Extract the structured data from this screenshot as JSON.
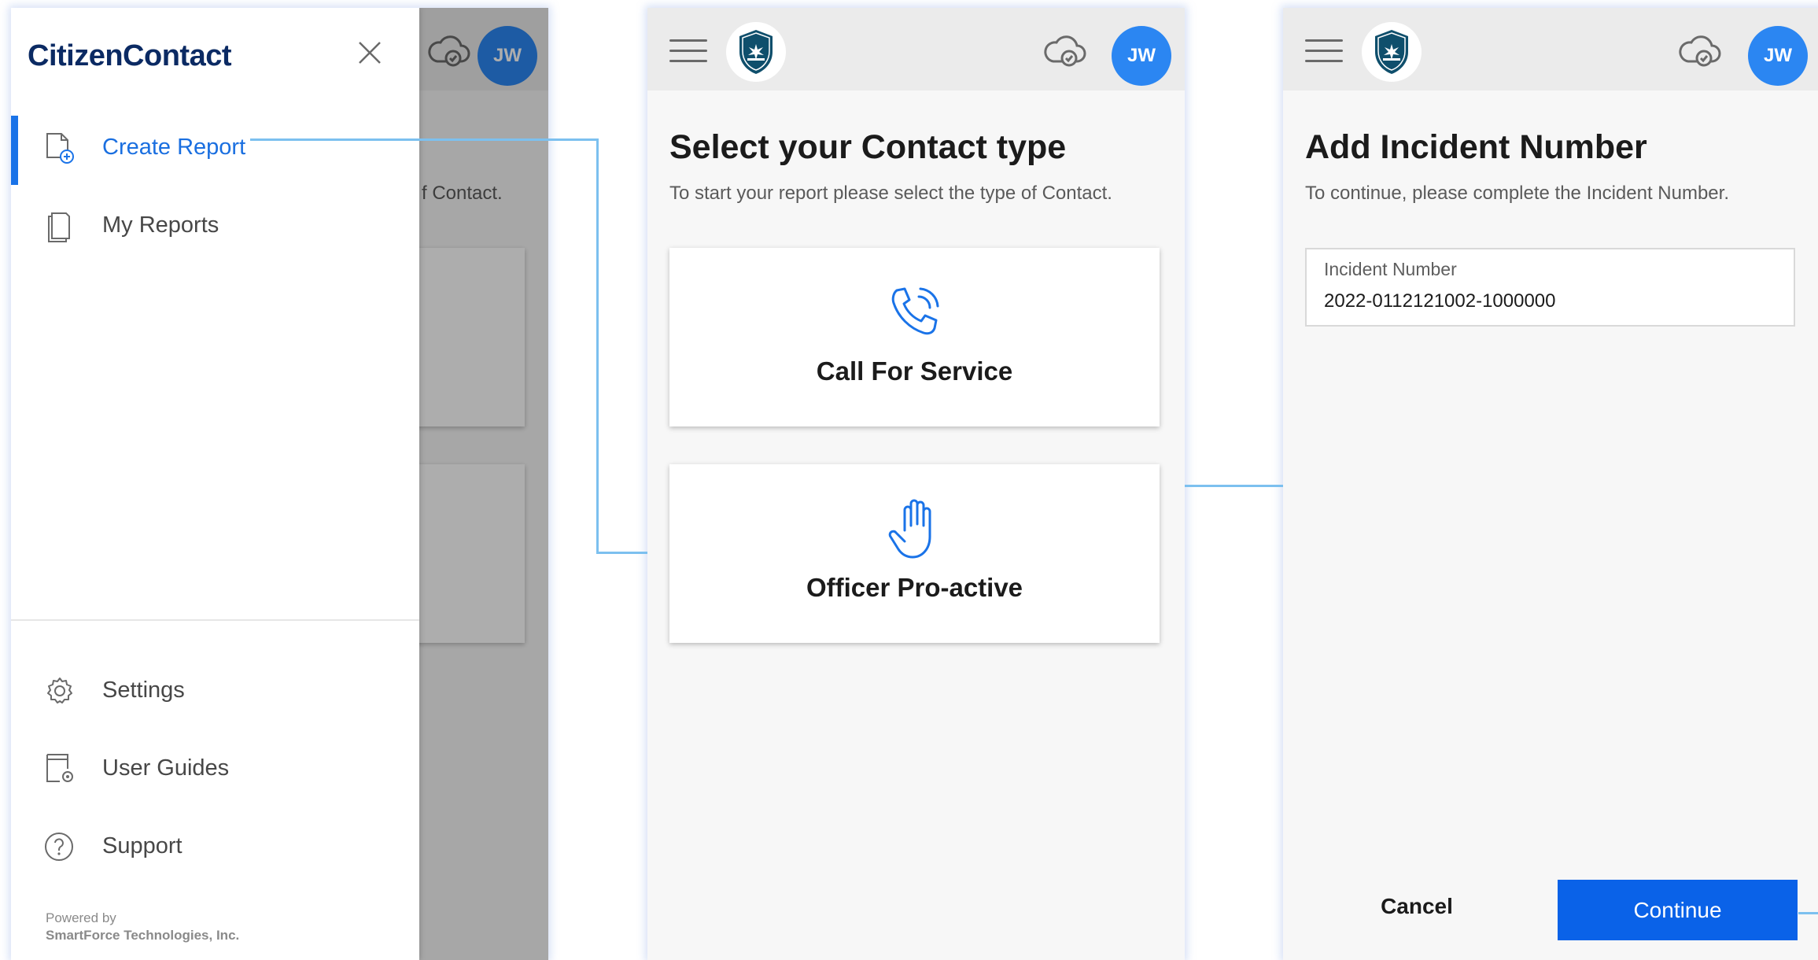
{
  "colors": {
    "accent": "#1a73e8",
    "primary_button": "#0a62e8",
    "avatar": "#2b86f2",
    "brand_navy": "#0b2a63",
    "connector": "#7cc0ef"
  },
  "header": {
    "avatar_initials": "JW",
    "menu_icon": "hamburger-icon",
    "badge_icon": "police-badge-icon",
    "sync_icon": "cloud-check-icon"
  },
  "drawer": {
    "brand": "CitizenContact",
    "close_icon": "close-icon",
    "items": [
      {
        "label": "Create Report",
        "icon": "create-report-icon",
        "active": true
      },
      {
        "label": "My Reports",
        "icon": "reports-icon",
        "active": false
      }
    ],
    "footer_items": [
      {
        "label": "Settings",
        "icon": "gear-icon"
      },
      {
        "label": "User Guides",
        "icon": "user-guides-icon"
      },
      {
        "label": "Support",
        "icon": "help-icon"
      }
    ],
    "powered_by": "Powered by",
    "company": "SmartForce Technologies, Inc."
  },
  "background_page": {
    "subtitle_fragment": "f Contact."
  },
  "contact_type": {
    "title": "Select your Contact type",
    "subtitle": "To start your report please select the type of Contact.",
    "options": [
      {
        "label": "Call For Service",
        "icon": "phone-call-icon"
      },
      {
        "label": "Officer Pro-active",
        "icon": "raised-hand-icon"
      }
    ]
  },
  "incident": {
    "title": "Add Incident Number",
    "subtitle": "To continue, please complete the Incident Number.",
    "field_label": "Incident Number",
    "field_value": "2022-0112121002-1000000",
    "cancel_label": "Cancel",
    "continue_label": "Continue"
  }
}
